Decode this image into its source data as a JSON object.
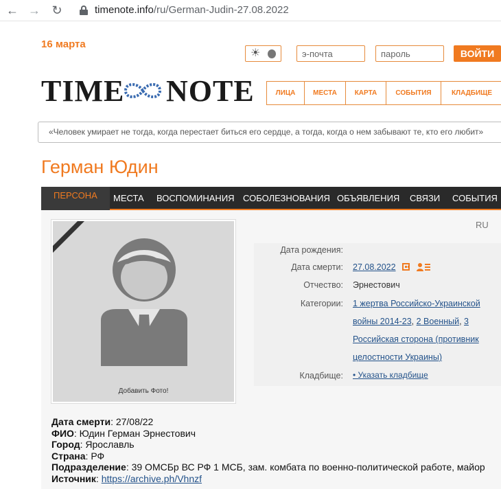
{
  "browser": {
    "url_host": "timenote.info",
    "url_path": "/ru/German-Judin-27.08.2022"
  },
  "header": {
    "date": "16 марта",
    "email_placeholder": "э-почта",
    "password_placeholder": "пароль",
    "login_label": "ВОЙТИ",
    "logo_left": "TIME",
    "logo_right": "NOTE",
    "nav": [
      "ЛИЦА",
      "МЕСТА",
      "КАРТА",
      "СОБЫТИЯ",
      "КЛАДБИЩЕ"
    ],
    "quote": "«Человек умирает не тогда, когда перестает биться его сердце, а тогда, когда о нем забывают те, кто его любит»"
  },
  "person": {
    "name": "Герман Юдин",
    "lang": "RU",
    "add_photo": "Добавить Фото!"
  },
  "tabs": [
    "ПЕРСОНА",
    "МЕСТА",
    "ВОСПОМИНАНИЯ",
    "СОБОЛЕЗНОВАНИЯ",
    "ОБЪЯВЛЕНИЯ",
    "СВЯЗИ",
    "СОБЫТИЯ"
  ],
  "info": {
    "birth_label": "Дата рождения:",
    "death_label": "Дата смерти:",
    "death_value": "27.08.2022",
    "patronymic_label": "Отчество:",
    "patronymic_value": "Эрнестович",
    "categories_label": "Категории:",
    "categories_line1": "1 жертва Российско-Украинской",
    "categories_line2a": "войны 2014-23",
    "categories_sep1": ", ",
    "categories_line2b": "2 Военный",
    "categories_sep2": ", ",
    "categories_line2c": "3",
    "categories_line3": "Российская сторона (противник",
    "categories_line4": "целостности Украины)",
    "cemetery_label": "Кладбище:",
    "cemetery_value": "• Указать кладбище"
  },
  "details": {
    "death_label": "Дата смерти",
    "death_value": ": 27/08/22",
    "fio_label": "ФИО",
    "fio_value": ": Юдин Герман Эрнестович",
    "city_label": "Город",
    "city_value": ": Ярославль",
    "country_label": "Страна",
    "country_value": ": РФ",
    "unit_label": "Подразделение",
    "unit_value": ": 39 ОМСБр ВС РФ 1 МСБ, зам. комбата по военно-политической работе, майор",
    "source_label": "Источник",
    "source_sep": ": ",
    "source_link": "https://archive.ph/Vhnzf"
  },
  "colors": {
    "accent": "#f07a20",
    "tab_bar": "#2a2a2a",
    "link": "#23528a"
  }
}
